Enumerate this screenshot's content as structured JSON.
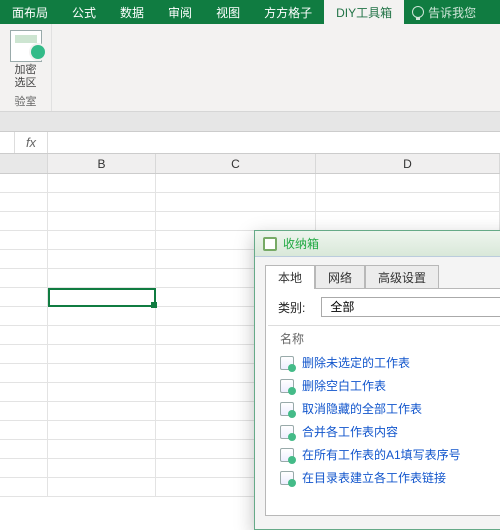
{
  "ribbon_tabs": {
    "t0": "面布局",
    "t1": "公式",
    "t2": "数据",
    "t3": "审阅",
    "t4": "视图",
    "t5": "方方格子",
    "t6": "DIY工具箱",
    "tell": "告诉我您"
  },
  "ribbon_group": {
    "line1": "加密",
    "line2": "选区",
    "footer": "验室"
  },
  "formula_bar": {
    "fx": "fx",
    "value": ""
  },
  "columns": {
    "B": "B",
    "C": "C",
    "D": "D"
  },
  "dialog": {
    "title": "收纳箱",
    "tabs": {
      "local": "本地",
      "net": "网络",
      "adv": "高级设置"
    },
    "category_label": "类别:",
    "category_value": "全部",
    "list_header": "名称",
    "items": {
      "i0": "删除未选定的工作表",
      "i1": "删除空白工作表",
      "i2": "取消隐藏的全部工作表",
      "i3": "合并各工作表内容",
      "i4": "在所有工作表的A1填写表序号",
      "i5": "在目录表建立各工作表链接"
    }
  }
}
